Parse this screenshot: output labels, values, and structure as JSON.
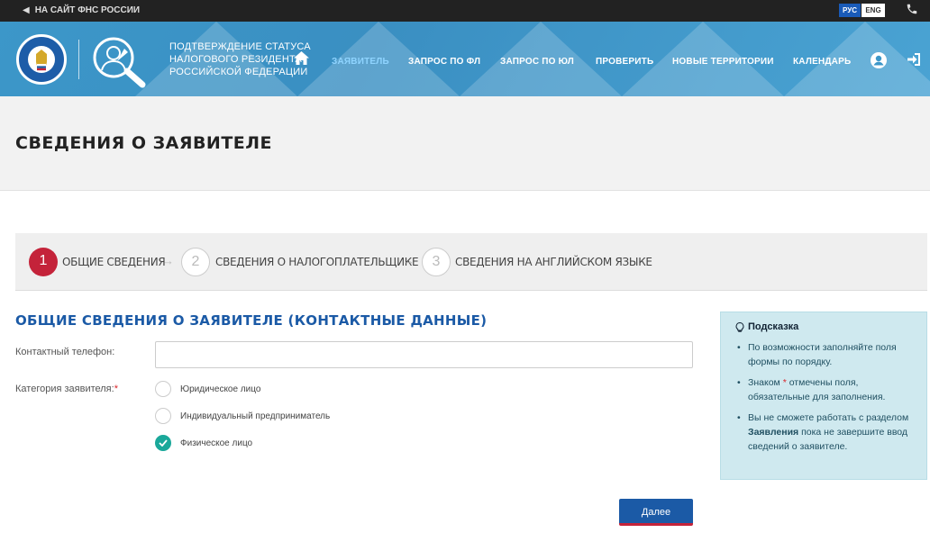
{
  "topbar": {
    "back_link": "НА САЙТ ФНС РОССИИ",
    "lang_ru": "РУС",
    "lang_en": "ENG"
  },
  "header": {
    "brand_line1": "ПОДТВЕРЖДЕНИЕ СТАТУСА",
    "brand_line2": "НАЛОГОВОГО РЕЗИДЕНТА",
    "brand_line3": "РОССИЙСКОЙ ФЕДЕРАЦИИ",
    "nav": [
      "ЗАЯВИТЕЛЬ",
      "ЗАПРОС ПО ФЛ",
      "ЗАПРОС ПО ЮЛ",
      "ПРОВЕРИТЬ",
      "НОВЫЕ ТЕРРИТОРИИ",
      "КАЛЕНДАРЬ"
    ],
    "accent": "#3c97c9"
  },
  "page_title": "СВЕДЕНИЯ О ЗАЯВИТЕЛЕ",
  "steps": [
    {
      "num": "1",
      "label": "ОБЩИЕ СВЕДЕНИЯ"
    },
    {
      "num": "2",
      "label": "СВЕДЕНИЯ О НАЛОГОПЛАТЕЛЬЩИКЕ"
    },
    {
      "num": "3",
      "label": "СВЕДЕНИЯ НА АНГЛИЙСКОМ ЯЗЫКЕ"
    }
  ],
  "form": {
    "title": "ОБЩИЕ СВЕДЕНИЯ О ЗАЯВИТЕЛЕ (КОНТАКТНЫЕ ДАННЫЕ)",
    "phone_label": "Контактный телефон:",
    "phone_value": "",
    "category_label": "Категория заявителя:",
    "required_mark": "*",
    "options": [
      "Юридическое лицо",
      "Индивидуальный предприниматель",
      "Физическое лицо"
    ],
    "selected": "Физическое лицо",
    "next_button": "Далее"
  },
  "hint": {
    "title": "Подсказка",
    "item1": "По возможности заполняйте поля формы по порядку.",
    "item2_pre": "Знаком",
    "item2_star": "*",
    "item2_post": "отмечены поля, обязательные для заполнения.",
    "item3_pre": "Вы не сможете работать с разделом",
    "item3_bold": "Заявления",
    "item3_post": "пока не завершите ввод сведений о заявителе."
  }
}
